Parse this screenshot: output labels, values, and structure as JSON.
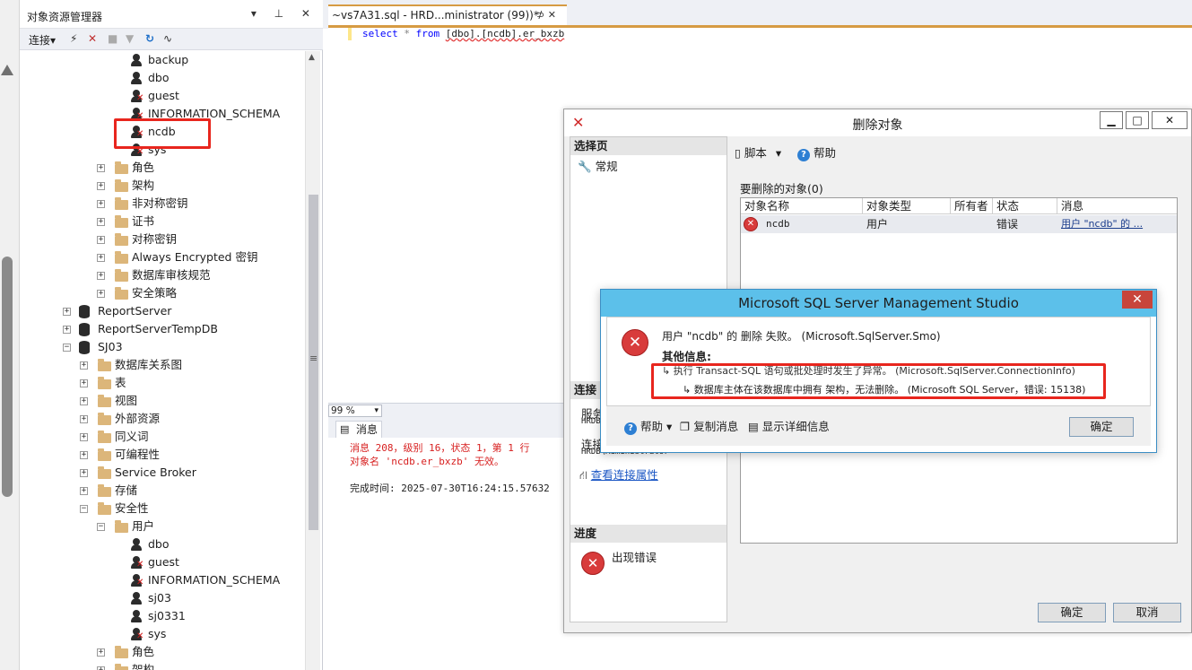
{
  "object_explorer": {
    "title": "对象资源管理器",
    "title_buttons": "▾ ⊥ ✕",
    "toolbar": {
      "connect": "连接▾"
    },
    "tree": [
      {
        "label": "backup",
        "kind": "user"
      },
      {
        "label": "dbo",
        "kind": "user"
      },
      {
        "label": "guest",
        "kind": "user-disabled"
      },
      {
        "label": "INFORMATION_SCHEMA",
        "kind": "user-disabled"
      },
      {
        "label": "ncdb",
        "kind": "user-disabled"
      },
      {
        "label": "sys",
        "kind": "user-disabled"
      },
      {
        "label": "角色",
        "kind": "folder"
      },
      {
        "label": "架构",
        "kind": "folder"
      },
      {
        "label": "非对称密钥",
        "kind": "folder"
      },
      {
        "label": "证书",
        "kind": "folder"
      },
      {
        "label": "对称密钥",
        "kind": "folder"
      },
      {
        "label": "Always Encrypted 密钥",
        "kind": "folder"
      },
      {
        "label": "数据库审核规范",
        "kind": "folder"
      },
      {
        "label": "安全策略",
        "kind": "folder"
      },
      {
        "label": "ReportServer",
        "kind": "db"
      },
      {
        "label": "ReportServerTempDB",
        "kind": "db"
      },
      {
        "label": "SJ03",
        "kind": "db-open"
      },
      {
        "label": "数据库关系图",
        "kind": "folder"
      },
      {
        "label": "表",
        "kind": "folder"
      },
      {
        "label": "视图",
        "kind": "folder"
      },
      {
        "label": "外部资源",
        "kind": "folder"
      },
      {
        "label": "同义词",
        "kind": "folder"
      },
      {
        "label": "可编程性",
        "kind": "folder"
      },
      {
        "label": "Service Broker",
        "kind": "folder"
      },
      {
        "label": "存储",
        "kind": "folder"
      },
      {
        "label": "安全性",
        "kind": "folder-open"
      },
      {
        "label": "用户",
        "kind": "folder-open"
      },
      {
        "label": "dbo",
        "kind": "user"
      },
      {
        "label": "guest",
        "kind": "user-disabled"
      },
      {
        "label": "INFORMATION_SCHEMA",
        "kind": "user-disabled"
      },
      {
        "label": "sj03",
        "kind": "user"
      },
      {
        "label": "sj0331",
        "kind": "user"
      },
      {
        "label": "sys",
        "kind": "user-disabled"
      },
      {
        "label": "角色",
        "kind": "folder"
      },
      {
        "label": "架构",
        "kind": "folder"
      }
    ]
  },
  "editor": {
    "tab_title": "~vs7A31.sql - HRD...ministrator (99))*",
    "tab_buttons": "⊅ ✕",
    "sql": {
      "kw1": "select",
      "star": "*",
      "kw2": "from",
      "object": "[dbo].[ncdb].er_bxzb"
    },
    "zoom": "99 %",
    "results_tab": "消息",
    "messages": [
      {
        "text": "消息 208，级别 16，状态 1，第 1 行",
        "error": true
      },
      {
        "text": "对象名 'ncdb.er_bxzb' 无效。",
        "error": true
      },
      {
        "text": "",
        "error": false
      },
      {
        "text": "完成时间: 2025-07-30T16:24:15.57632",
        "error": false
      }
    ]
  },
  "delete_dialog": {
    "title": "删除对象",
    "title_icon": "✕",
    "controls": {
      "min": "▁",
      "max": "□",
      "close": "✕"
    },
    "select_page_header": "选择页",
    "pages": [
      "常规"
    ],
    "connection_header": "连接",
    "server_label": "服务",
    "server_value": "HRDB",
    "connection_label": "连接",
    "connection_value": "HRDB\\Administrator",
    "view_connection_props": "查看连接属性",
    "progress_header": "进度",
    "progress_status": "出现错误",
    "toolbar": {
      "script": "脚本",
      "help": "帮助"
    },
    "objects_label": "要删除的对象(0)",
    "columns": [
      "对象名称",
      "对象类型",
      "所有者",
      "状态",
      "消息"
    ],
    "row": {
      "name": "ncdb",
      "type": "用户",
      "owner": "",
      "status": "错误",
      "message": "用户 \"ncdb\" 的 ..."
    },
    "ok_button": "确定",
    "cancel_button": "取消"
  },
  "message_box": {
    "title": "Microsoft SQL Server Management Studio",
    "close": "✕",
    "main_message": "用户 \"ncdb\" 的 删除 失败。 (Microsoft.SqlServer.Smo)",
    "additional_info_label": "其他信息:",
    "detail_1": "执行 Transact-SQL 语句或批处理时发生了异常。 (Microsoft.SqlServer.ConnectionInfo)",
    "detail_2": "数据库主体在该数据库中拥有 架构，无法删除。 (Microsoft SQL Server，错误: 15138)",
    "help_button": "帮助",
    "copy_button": "复制消息",
    "details_button": "显示详细信息",
    "ok_button": "确定"
  }
}
